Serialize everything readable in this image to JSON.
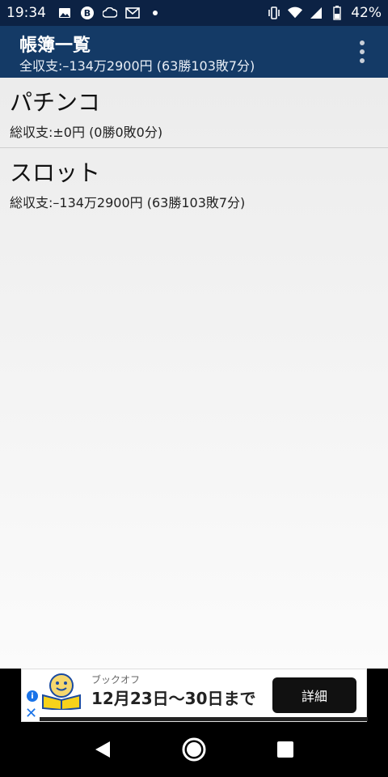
{
  "statusbar": {
    "time": "19:34",
    "battery": "42%"
  },
  "appbar": {
    "title": "帳簿一覧",
    "subtitle": "全収支:–134万2900円 (63勝103敗7分)"
  },
  "list": [
    {
      "title": "パチンコ",
      "summary": "総収支:±0円 (0勝0敗0分)"
    },
    {
      "title": "スロット",
      "summary": "総収支:–134万2900円 (63勝103敗7分)"
    }
  ],
  "ad": {
    "kana": "ブックオフ",
    "headline": "12月23日〜30日まで",
    "button": "詳細"
  },
  "icons": {
    "overflow": "more-vert-icon",
    "back": "back-icon",
    "home": "home-icon",
    "recents": "recents-icon"
  },
  "colors": {
    "statusbar": "#0c2244",
    "appbar": "#143a66"
  }
}
